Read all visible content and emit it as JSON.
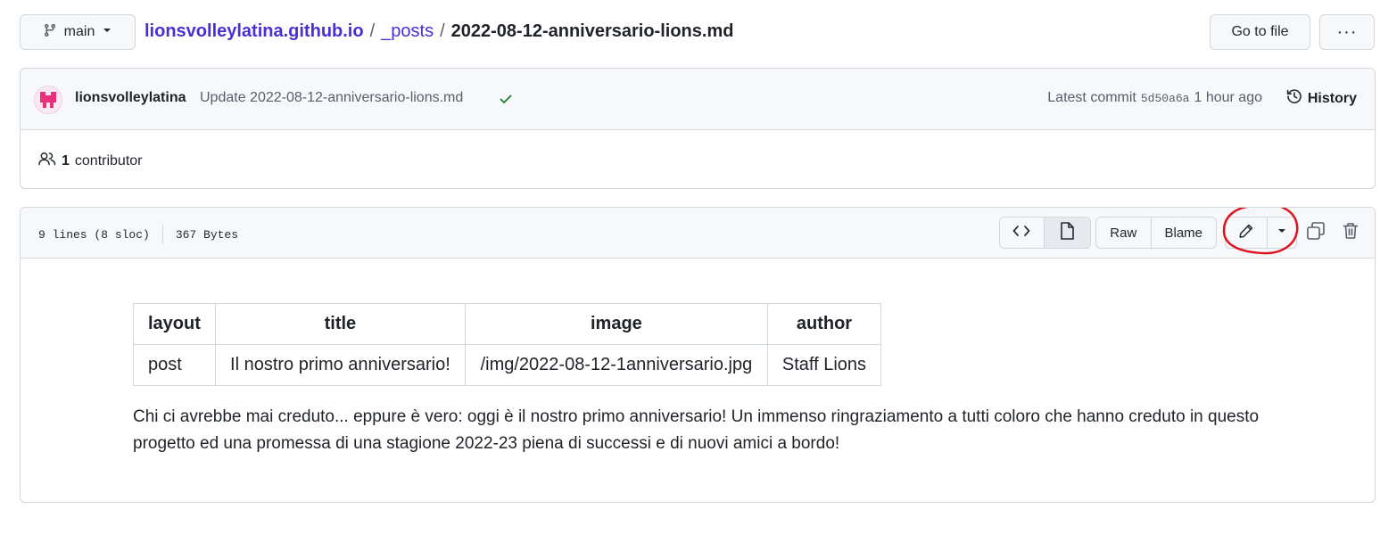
{
  "branch": {
    "label": "main"
  },
  "breadcrumb": {
    "repo": "lionsvolleylatina.github.io",
    "separator": "/",
    "dir": "_posts",
    "file": "2022-08-12-anniversario-lions.md"
  },
  "actions": {
    "goto_file": "Go to file",
    "more": "···"
  },
  "commit": {
    "author": "lionsvolleylatina",
    "message": "Update 2022-08-12-anniversario-lions.md",
    "latest_label": "Latest commit",
    "sha": "5d50a6a",
    "time": "1 hour ago",
    "history_label": "History"
  },
  "contributors": {
    "count": "1",
    "label": "contributor"
  },
  "file": {
    "lines": "9 lines (8 sloc)",
    "size": "367 Bytes",
    "raw_label": "Raw",
    "blame_label": "Blame"
  },
  "frontmatter": {
    "headers": [
      "layout",
      "title",
      "image",
      "author"
    ],
    "row": [
      "post",
      "Il nostro primo anniversario!",
      "/img/2022-08-12-1anniversario.jpg",
      "Staff Lions"
    ]
  },
  "body_text": "Chi ci avrebbe mai creduto... eppure è vero: oggi è il nostro primo anniversario! Un immenso ringraziamento a tutti coloro che hanno creduto in questo progetto ed una promessa di una stagione 2022-23 piena di successi e di nuovi amici a bordo!",
  "colors": {
    "link": "#4a2fd6",
    "success": "#1a7f37",
    "annotation": "#e0141e",
    "avatar": "#e8317a"
  },
  "icons": [
    "branch-icon",
    "caret-down-icon",
    "check-icon",
    "history-icon",
    "people-icon",
    "code-icon",
    "file-icon",
    "pencil-icon",
    "copy-icon",
    "trash-icon"
  ]
}
